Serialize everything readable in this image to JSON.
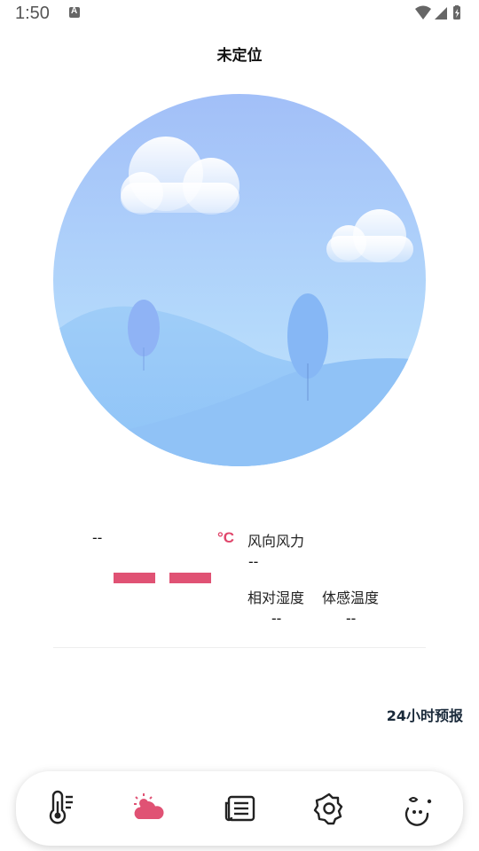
{
  "status_bar": {
    "time": "1:50",
    "notification_icon": "a-badge-icon",
    "icons": [
      "wifi-icon",
      "signal-icon",
      "battery-icon"
    ]
  },
  "header": {
    "title": "未定位"
  },
  "current": {
    "temperature": "--",
    "temperature_unit": "°C",
    "wind_label": "风向风力",
    "wind_value": "--",
    "humidity_label": "相对湿度",
    "humidity_value": "--",
    "feels_like_label": "体感温度",
    "feels_like_value": "--"
  },
  "forecast_link": "24小时预报",
  "bottom_nav": {
    "items": [
      {
        "icon": "thermometer-icon",
        "active": false
      },
      {
        "icon": "weather-cloud-sun-icon",
        "active": true
      },
      {
        "icon": "news-icon",
        "active": false
      },
      {
        "icon": "settings-icon",
        "active": false
      },
      {
        "icon": "leaf-drop-icon",
        "active": false
      }
    ]
  },
  "colors": {
    "accent": "#e05274",
    "unit": "#e0466b",
    "sky_top": "#a4c2f8",
    "hill": "#8ec0f6"
  }
}
